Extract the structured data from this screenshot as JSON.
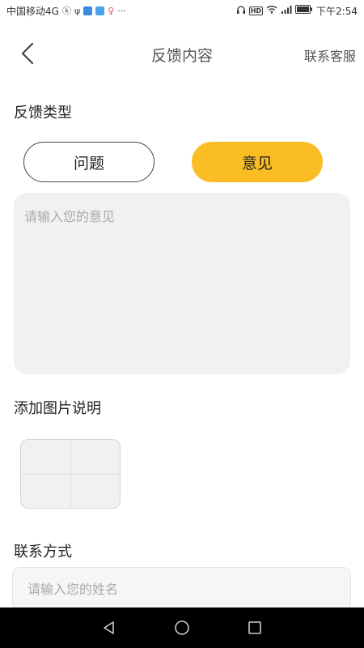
{
  "status_bar": {
    "carrier": "中国移动4G",
    "time": "下午2:54",
    "icons_left": [
      "k-circle-icon",
      "usb-icon",
      "shield-app-icon",
      "app-icon",
      "location-icon",
      "more-icon"
    ],
    "icons_right": [
      "headset-icon",
      "hd-icon",
      "wifi-icon",
      "signal-icon",
      "battery-icon"
    ],
    "more": "···",
    "hd": "HD"
  },
  "header": {
    "title": "反馈内容",
    "service_label": "联系客服"
  },
  "feedback_type": {
    "label": "反馈类型",
    "options": [
      "问题",
      "意见"
    ],
    "selected": "意见"
  },
  "feedback_input": {
    "placeholder": "请输入您的意见",
    "value": ""
  },
  "image_section": {
    "label": "添加图片说明"
  },
  "contact": {
    "label": "联系方式",
    "name_placeholder": "请输入您的姓名",
    "name_value": ""
  },
  "colors": {
    "accent": "#fbbd24",
    "input_bg": "#f1f1f1",
    "nav_bg": "#000000"
  }
}
